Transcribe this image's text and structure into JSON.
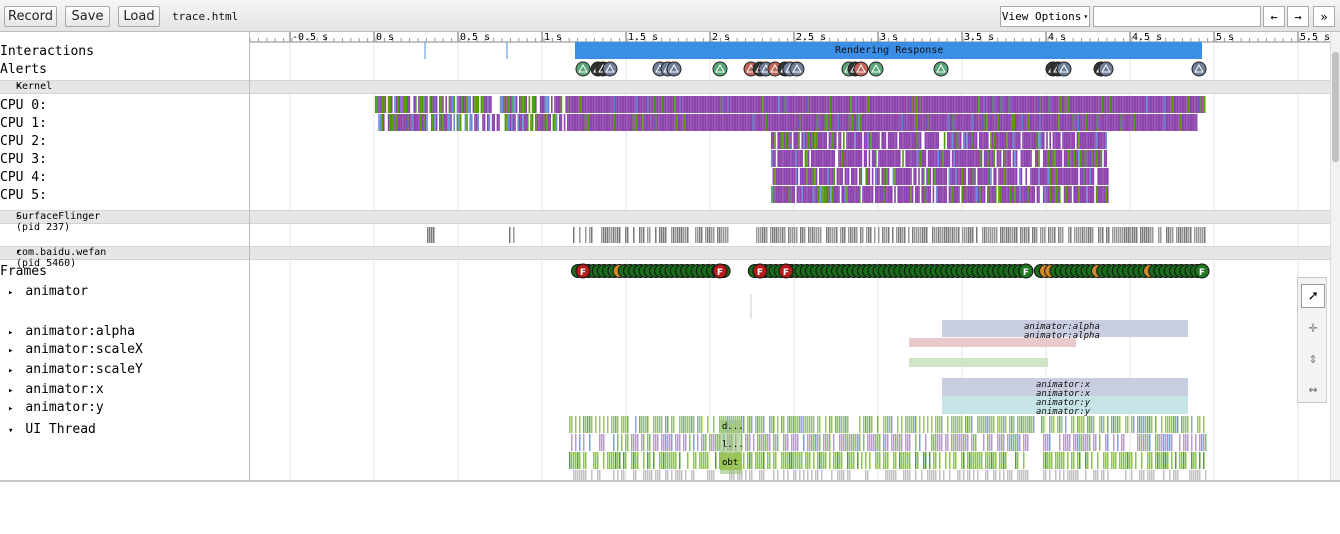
{
  "toolbar": {
    "record": "Record",
    "save": "Save",
    "load": "Load",
    "trace_name": "trace.html",
    "view_options": "View Options",
    "view_options_arrow": "▾",
    "search_placeholder": "",
    "prev": "←",
    "next": "→",
    "more": "»"
  },
  "ruler": {
    "ticks": [
      "-0.5 s",
      "0 s",
      "0.5 s",
      "1 s",
      "1.5 s",
      "2 s",
      "2.5 s",
      "3 s",
      "3.5 s",
      "4 s",
      "4.5 s",
      "5 s",
      "5.5 s"
    ]
  },
  "tracks": {
    "interactions": "Interactions",
    "alerts": "Alerts",
    "rendering_response": "Rendering Response",
    "kernel": "Kernel",
    "cpus": [
      "CPU 0:",
      "CPU 1:",
      "CPU 2:",
      "CPU 3:",
      "CPU 4:",
      "CPU 5:"
    ],
    "surfaceflinger": "SurfaceFlinger (pid 237)",
    "process": "com.baidu.wefan (pid 5460)",
    "frames": "Frames",
    "threads": [
      "animator",
      "animator:alpha",
      "animator:scaleX",
      "animator:scaleY",
      "animator:x",
      "animator:y",
      "UI Thread"
    ],
    "expand_arrow": "▸",
    "collapse_arrow": "▾",
    "alert_glyph": "⚠",
    "frame_glyph": "F"
  },
  "slices": {
    "alpha1": "animator:alpha",
    "alpha2": "animator:alpha",
    "x1": "animator:x",
    "x2": "animator:x",
    "y1": "animator:y",
    "y2": "animator:y",
    "ui1": "d...",
    "ui2": "l...",
    "ui3": "obt"
  },
  "colors": {
    "purple": "#8e44ad",
    "green": "#4e9a06",
    "blue": "#4a90e2",
    "response_blue": "#3a8ee6",
    "alert_green": "#5aa57a",
    "alert_grey": "#6f7f99",
    "alert_red": "#c0645a",
    "frame_green": "#1a6b1a",
    "frame_orange": "#d0892c",
    "frame_red": "#b51c1c"
  }
}
